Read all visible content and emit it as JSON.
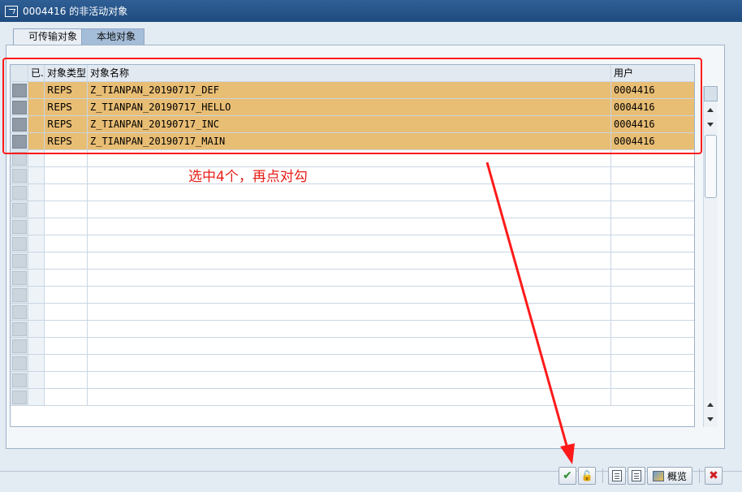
{
  "window": {
    "title": "0004416 的非活动对象"
  },
  "tabs": [
    {
      "label": "可传输对象",
      "active": false
    },
    {
      "label": "本地对象",
      "active": true
    }
  ],
  "table": {
    "columns": {
      "done": "已.",
      "type": "对象类型",
      "name": "对象名称",
      "user": "用户"
    },
    "rows": [
      {
        "type": "REPS",
        "name": "Z_TIANPAN_20190717_DEF",
        "user": "0004416"
      },
      {
        "type": "REPS",
        "name": "Z_TIANPAN_20190717_HELLO",
        "user": "0004416"
      },
      {
        "type": "REPS",
        "name": "Z_TIANPAN_20190717_INC",
        "user": "0004416"
      },
      {
        "type": "REPS",
        "name": "Z_TIANPAN_20190717_MAIN",
        "user": "0004416"
      }
    ],
    "empty_rows": 15
  },
  "annotation": {
    "text": "选中4个，再点对勾",
    "color": "#e8201a"
  },
  "toolbar": {
    "overview_label": "概览"
  },
  "icons": [
    "check-icon",
    "lock-icon",
    "doc-icon",
    "overview-icon",
    "x-icon"
  ]
}
